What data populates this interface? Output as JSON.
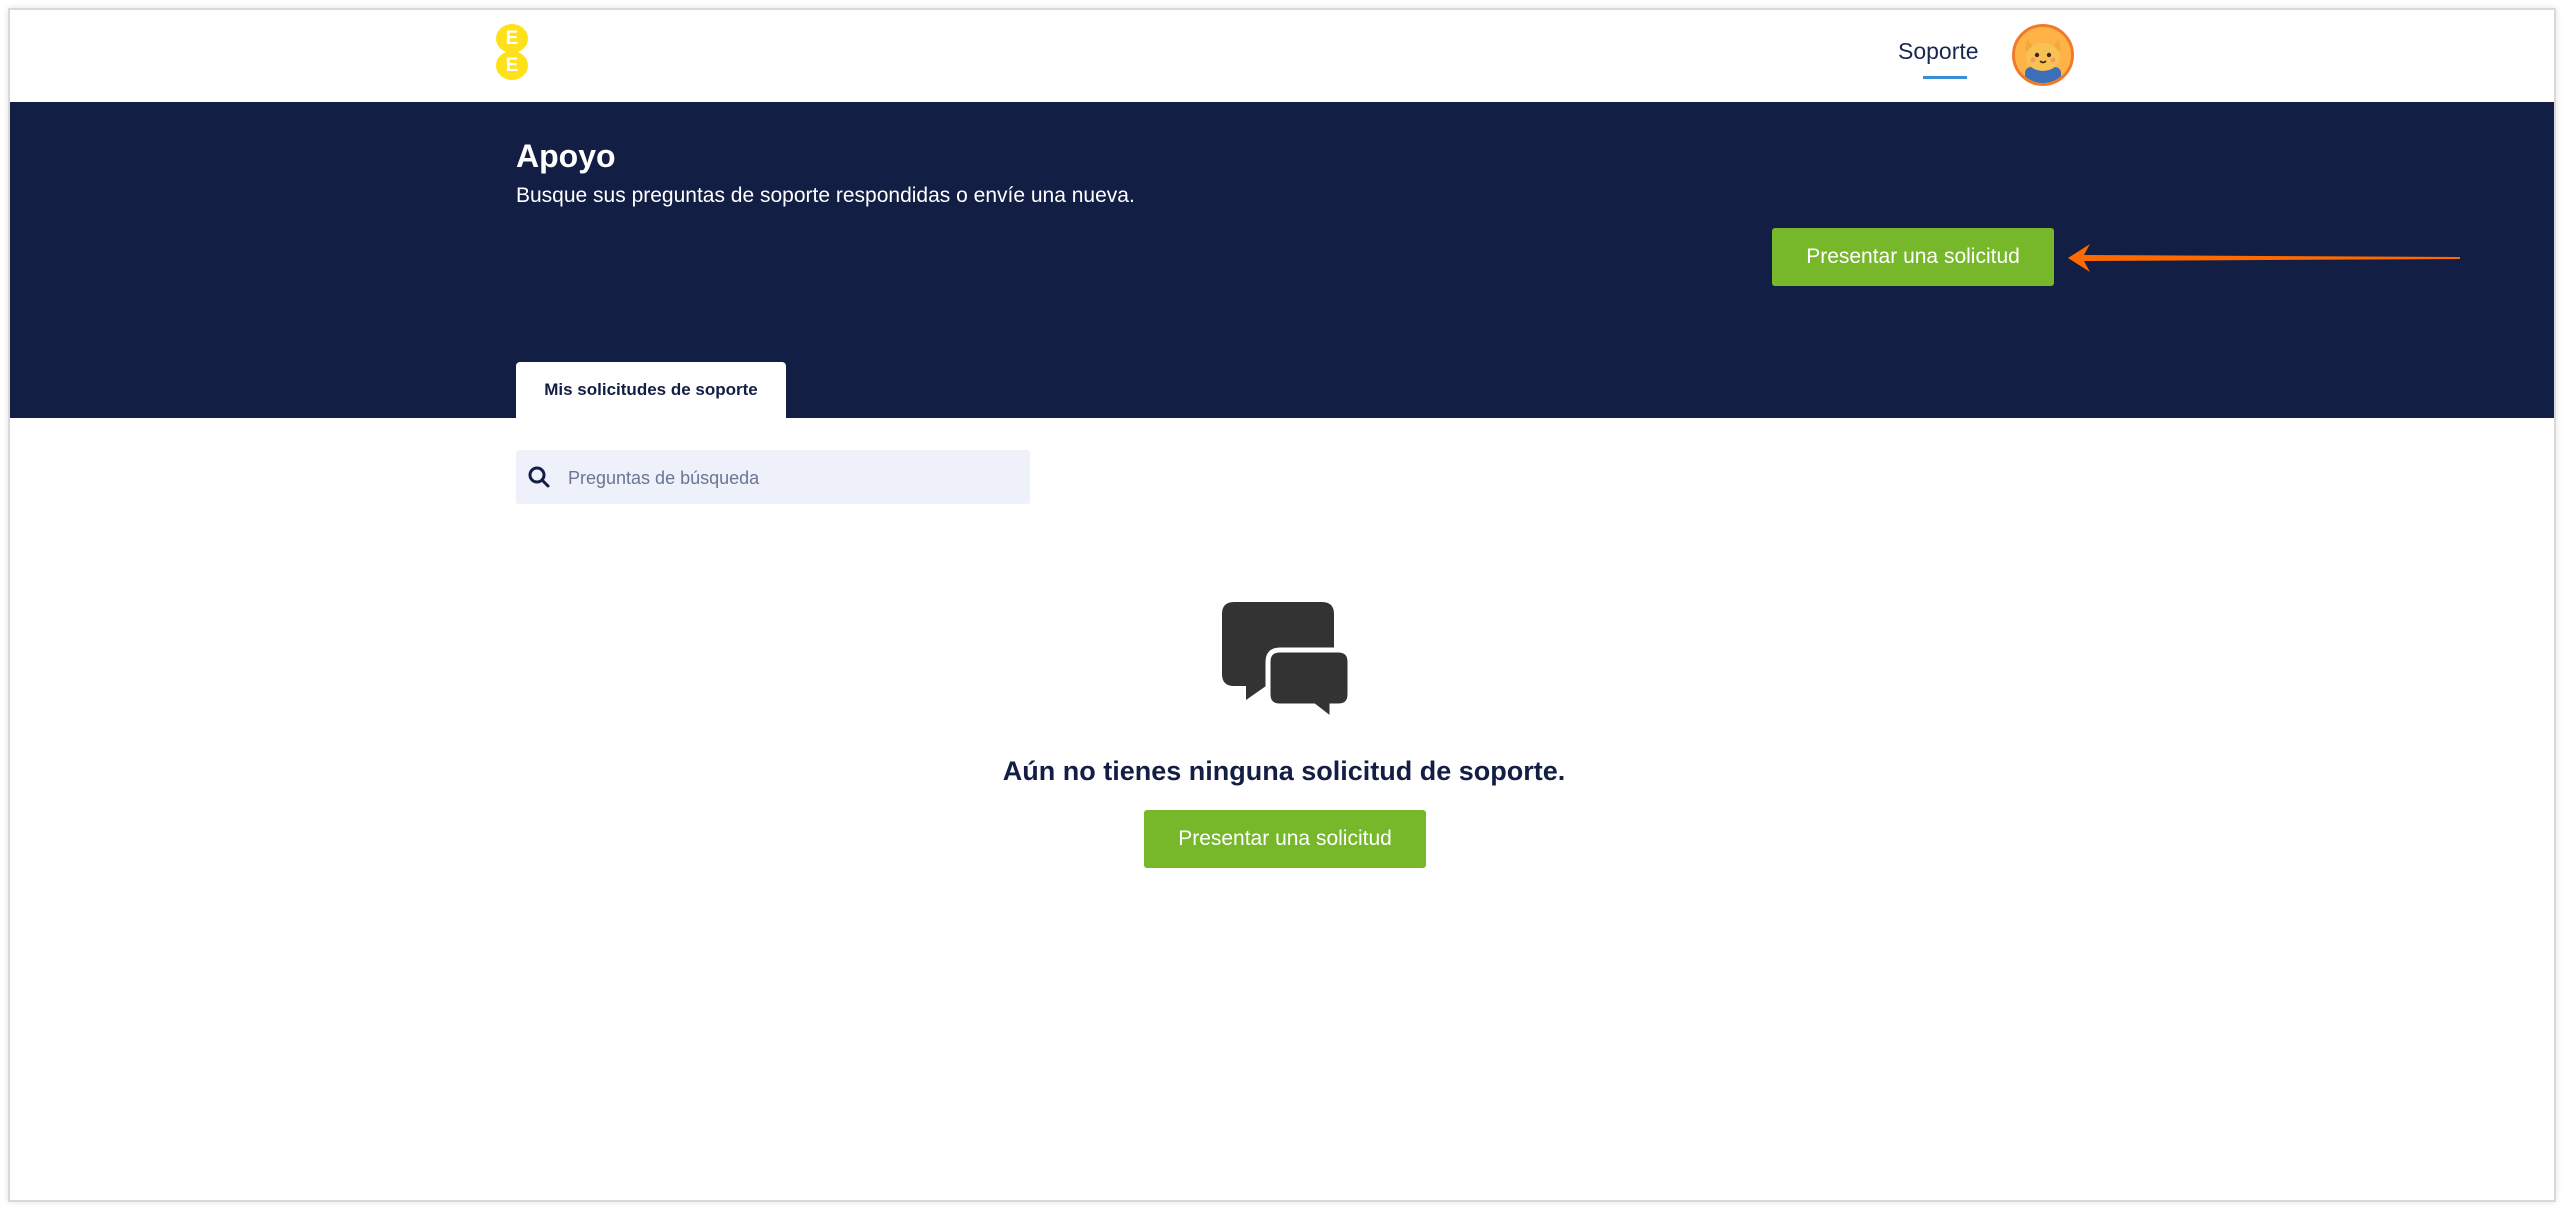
{
  "header": {
    "logo_letters": [
      "E",
      "E"
    ],
    "nav_support": "Soporte",
    "colors": {
      "logo": "#ffe11a",
      "avatar_ring": "#f07a2a",
      "nav_underline": "#3a8fd6"
    }
  },
  "hero": {
    "title": "Apoyo",
    "subtitle": "Busque sus preguntas de soporte respondidas o envíe una nueva.",
    "submit_button": "Presentar una solicitud",
    "background": "#131e45",
    "button_color": "#76b82a",
    "annotation_arrow_color": "#ff6a00"
  },
  "tabs": [
    {
      "label": "Mis solicitudes de soporte",
      "active": true
    }
  ],
  "search": {
    "placeholder": "Preguntas de búsqueda",
    "value": ""
  },
  "empty_state": {
    "icon": "chat-bubbles-icon",
    "message": "Aún no tienes ninguna solicitud de soporte.",
    "button": "Presentar una solicitud"
  }
}
